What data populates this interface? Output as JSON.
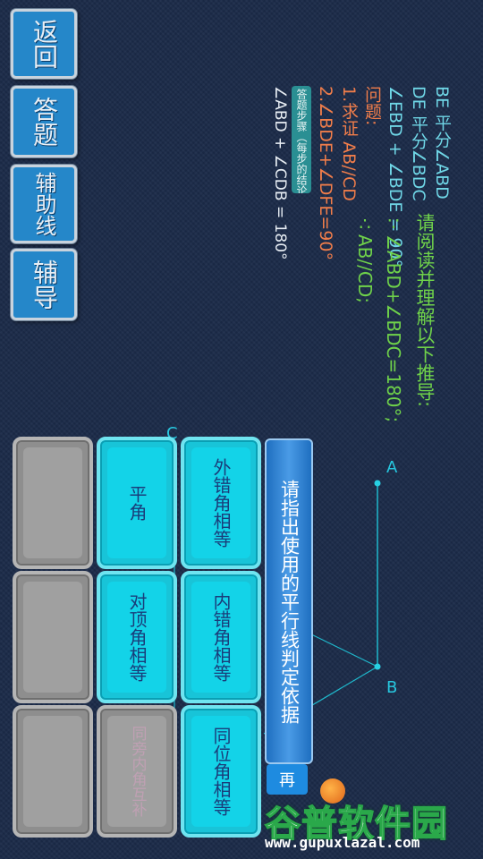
{
  "nav": {
    "back": "返回",
    "answer": "答题",
    "aux_line": "辅助线",
    "tutor": "辅导"
  },
  "given": {
    "line1": "BE 平分∠ABD",
    "line2": "DE 平分∠BDC",
    "line3": "∠EBD + ∠BDE = 90°"
  },
  "question": {
    "heading": "问题:",
    "item": "1.求证 AB//CD"
  },
  "steps_badge": "答题步骤（每步的结论）:",
  "step2": "2.∠BDE+∠DFE=90°",
  "step_sum": "∠ABD + ∠CDB = 180°",
  "reasoning": {
    "prompt": "请阅读并理解以下推导:",
    "line1": "∵∠ABD+∠BDC=180°;",
    "line2": "∴AB//CD;"
  },
  "figure": {
    "label_a": "A",
    "label_b": "B",
    "label_c": "C"
  },
  "banner": "请指出使用的平行线判定依据",
  "confirm_label": "再",
  "options": [
    {
      "label": "外错角相等",
      "state": "active"
    },
    {
      "label": "平角",
      "state": "active"
    },
    {
      "label": "",
      "state": "disabled"
    },
    {
      "label": "内错角相等",
      "state": "active"
    },
    {
      "label": "对顶角相等",
      "state": "active"
    },
    {
      "label": "",
      "state": "disabled"
    },
    {
      "label": "同位角相等",
      "state": "active"
    },
    {
      "label": "同旁内角互补",
      "state": "disabled"
    },
    {
      "label": "",
      "state": "disabled"
    }
  ],
  "watermark": {
    "brand": "谷普软件园",
    "url": "www.gupuxlazal.com"
  },
  "colors": {
    "cyan": "#18c4d8",
    "given_text": "#6fd6e6",
    "question_text": "#f07d4a",
    "reasoning_text": "#6fd24a",
    "banner": "#2f7fd0"
  }
}
